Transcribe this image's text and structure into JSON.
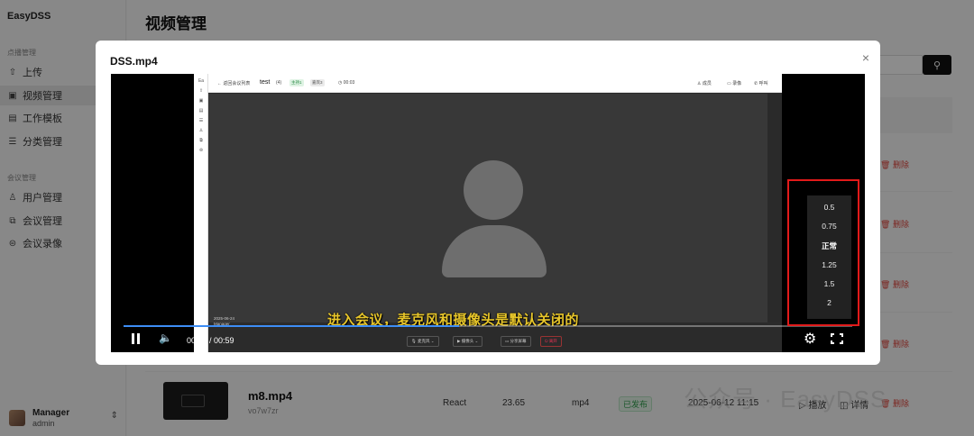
{
  "app": {
    "brand": "EasyDSS"
  },
  "sidebar": {
    "groups": [
      {
        "title": "点播管理"
      },
      {
        "title": "会议管理"
      }
    ],
    "items": [
      {
        "label": "上传",
        "icon": "upload-icon"
      },
      {
        "label": "视频管理",
        "icon": "video-icon",
        "active": true
      },
      {
        "label": "工作模板",
        "icon": "template-icon"
      },
      {
        "label": "分类管理",
        "icon": "list-icon"
      },
      {
        "label": "用户管理",
        "icon": "user-icon"
      },
      {
        "label": "会议管理",
        "icon": "meeting-icon"
      },
      {
        "label": "会议录像",
        "icon": "record-icon"
      }
    ],
    "user": {
      "name": "Manager",
      "role": "admin"
    }
  },
  "main": {
    "title": "视频管理",
    "delete_label": "删除",
    "last_row": {
      "name": "m8.mp4",
      "id": "vo7w7zr",
      "framework": "React",
      "size": "23.65",
      "format": "mp4",
      "status": "已发布",
      "date": "2025-06-12 11:15",
      "play_label": "播放",
      "detail_label": "详情"
    }
  },
  "watermark": "公众号 · EasyDSS",
  "modal": {
    "title": "DSS.mp4",
    "close": "×",
    "player": {
      "subtitle": "进入会议，麦克风和摄像头是默认关闭的",
      "time": "00:27 / 00:59",
      "progress": 0.46,
      "speed_options": [
        "0.5",
        "0.75",
        "正常",
        "1.25",
        "1.5",
        "2"
      ],
      "selected_speed": "正常",
      "inner": {
        "back": "← 返回会议列表",
        "meeting": "test",
        "count": "(4)",
        "tag1": "主持1",
        "tag2": "嘉宾3",
        "timer": "◷ 00:03",
        "members": "成员",
        "record": "录像",
        "call": "呼叫",
        "date": "2025-06-24",
        "user": "Manager",
        "mic": "麦克风",
        "camera": "摄像头",
        "share": "分享屏幕",
        "leave": "离开"
      }
    }
  }
}
